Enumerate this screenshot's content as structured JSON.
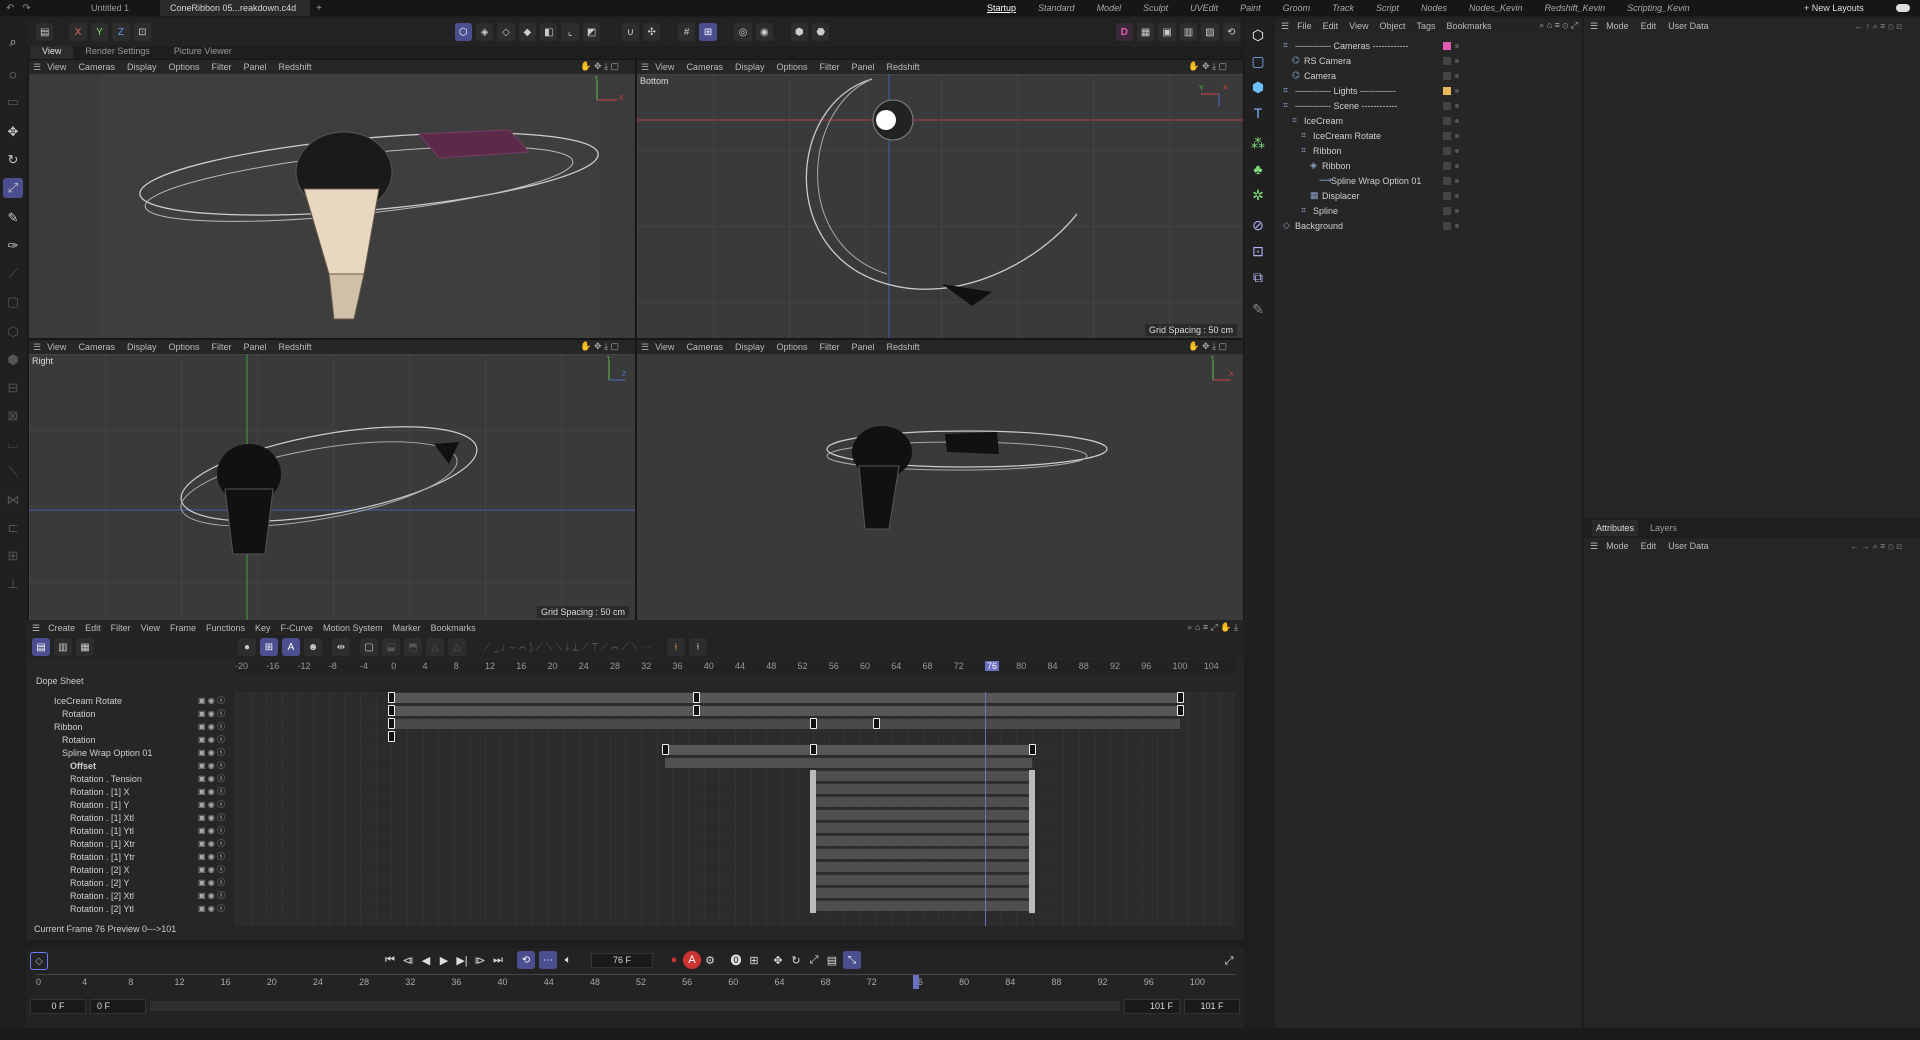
{
  "top_bar": {
    "doc_tabs": [
      "Untitled 1",
      "ConeRibbon 05...reakdown.c4d *"
    ],
    "add_tab": "+",
    "layouts": [
      "Startup",
      "Standard",
      "Model",
      "Sculpt",
      "UVEdit",
      "Paint",
      "Groom",
      "Track",
      "Script",
      "Nodes",
      "Nodes_Kevin",
      "Redshift_Kevin",
      "Scripting_Kevin"
    ],
    "selected_layout": "Startup",
    "new_layouts": "New Layouts"
  },
  "toolbar": {
    "axes": [
      "X",
      "Y",
      "Z"
    ],
    "d_badge": "D"
  },
  "view_tabs": [
    "View",
    "Render Settings",
    "Picture Viewer"
  ],
  "viewport_menu": [
    "View",
    "Cameras",
    "Display",
    "Options",
    "Filter",
    "Panel",
    "Redshift"
  ],
  "viewports": {
    "top_left": {
      "label": "",
      "grid": ""
    },
    "top_right": {
      "label": "Bottom",
      "grid": "Grid Spacing : 50 cm"
    },
    "bottom_left": {
      "label": "Right",
      "grid": "Grid Spacing : 50 cm"
    },
    "bottom_right": {
      "label": "",
      "grid": ""
    }
  },
  "object_manager": {
    "menu": [
      "File",
      "Edit",
      "View",
      "Object",
      "Tags",
      "Bookmarks"
    ],
    "rows": [
      {
        "name": "------------ Cameras ------------",
        "indent": 0,
        "icon": "null-icon",
        "color": "#e05ab0"
      },
      {
        "name": "RS Camera",
        "indent": 1,
        "icon": "camera-icon",
        "color": ""
      },
      {
        "name": "Camera",
        "indent": 1,
        "icon": "camera-icon",
        "color": ""
      },
      {
        "name": "------------ Lights ------------",
        "indent": 0,
        "icon": "null-icon",
        "color": "#e8b85a"
      },
      {
        "name": "------------ Scene ------------",
        "indent": 0,
        "icon": "null-icon",
        "color": ""
      },
      {
        "name": "IceCream",
        "indent": 1,
        "icon": "null-icon",
        "color": ""
      },
      {
        "name": "IceCream Rotate",
        "indent": 2,
        "icon": "null-icon",
        "color": ""
      },
      {
        "name": "Ribbon",
        "indent": 2,
        "icon": "null-icon",
        "color": ""
      },
      {
        "name": "Ribbon",
        "indent": 3,
        "icon": "sweep-icon",
        "color": ""
      },
      {
        "name": "Spline Wrap Option 01",
        "indent": 4,
        "icon": "spline-wrap-icon",
        "color": ""
      },
      {
        "name": "Displacer",
        "indent": 3,
        "icon": "displacer-icon",
        "color": ""
      },
      {
        "name": "Spline",
        "indent": 2,
        "icon": "null-icon",
        "color": ""
      },
      {
        "name": "Background",
        "indent": 0,
        "icon": "background-icon",
        "color": ""
      }
    ]
  },
  "mode_menu": [
    "Mode",
    "Edit",
    "User Data"
  ],
  "attributes": {
    "tabs": [
      "Attributes",
      "Layers"
    ],
    "menu": [
      "Mode",
      "Edit",
      "User Data"
    ]
  },
  "timeline": {
    "menu": [
      "Create",
      "Edit",
      "Filter",
      "View",
      "Frame",
      "Functions",
      "Key",
      "F-Curve",
      "Motion System",
      "Marker",
      "Bookmarks"
    ],
    "title": "Dope Sheet",
    "ruler": [
      "-20",
      "-16",
      "-12",
      "-8",
      "-4",
      "0",
      "4",
      "8",
      "12",
      "16",
      "20",
      "24",
      "28",
      "32",
      "36",
      "40",
      "44",
      "48",
      "52",
      "56",
      "60",
      "64",
      "68",
      "72",
      "76",
      "80",
      "84",
      "88",
      "92",
      "96",
      "100",
      "104"
    ],
    "current_marker": "76",
    "tracks": [
      {
        "name": "IceCream Rotate",
        "indent": 1,
        "bold": false
      },
      {
        "name": "Rotation",
        "indent": 2,
        "bold": false
      },
      {
        "name": "Ribbon",
        "indent": 1,
        "bold": false
      },
      {
        "name": "Rotation",
        "indent": 2,
        "bold": false
      },
      {
        "name": "Spline Wrap Option 01",
        "indent": 2,
        "bold": false
      },
      {
        "name": "Offset",
        "indent": 3,
        "bold": true
      },
      {
        "name": "Rotation . Tension",
        "indent": 3,
        "bold": false
      },
      {
        "name": "Rotation . [1] X",
        "indent": 3,
        "bold": false
      },
      {
        "name": "Rotation . [1] Y",
        "indent": 3,
        "bold": false
      },
      {
        "name": "Rotation . [1] Xtl",
        "indent": 3,
        "bold": false
      },
      {
        "name": "Rotation . [1] Ytl",
        "indent": 3,
        "bold": false
      },
      {
        "name": "Rotation . [1] Xtr",
        "indent": 3,
        "bold": false
      },
      {
        "name": "Rotation . [1] Ytr",
        "indent": 3,
        "bold": false
      },
      {
        "name": "Rotation . [2] X",
        "indent": 3,
        "bold": false
      },
      {
        "name": "Rotation . [2] Y",
        "indent": 3,
        "bold": false
      },
      {
        "name": "Rotation . [2] Xtl",
        "indent": 3,
        "bold": false
      },
      {
        "name": "Rotation . [2] Ytl",
        "indent": 3,
        "bold": false
      }
    ],
    "status": "Current Frame  76  Preview  0--->101"
  },
  "transport": {
    "frame_field": "76 F",
    "ruler": [
      "0",
      "4",
      "8",
      "12",
      "16",
      "20",
      "24",
      "28",
      "32",
      "36",
      "40",
      "44",
      "48",
      "52",
      "56",
      "60",
      "64",
      "68",
      "72",
      "76",
      "80",
      "84",
      "88",
      "92",
      "96",
      "100"
    ],
    "current_frame": 76,
    "start_a": "0 F",
    "start_b": "0 F",
    "end_a": "101 F",
    "end_b": "101 F"
  },
  "colors": {
    "accent": "#4b4f8f",
    "x_axis": "#d04040",
    "y_axis": "#5fc04a",
    "z_axis": "#4a70d0"
  }
}
